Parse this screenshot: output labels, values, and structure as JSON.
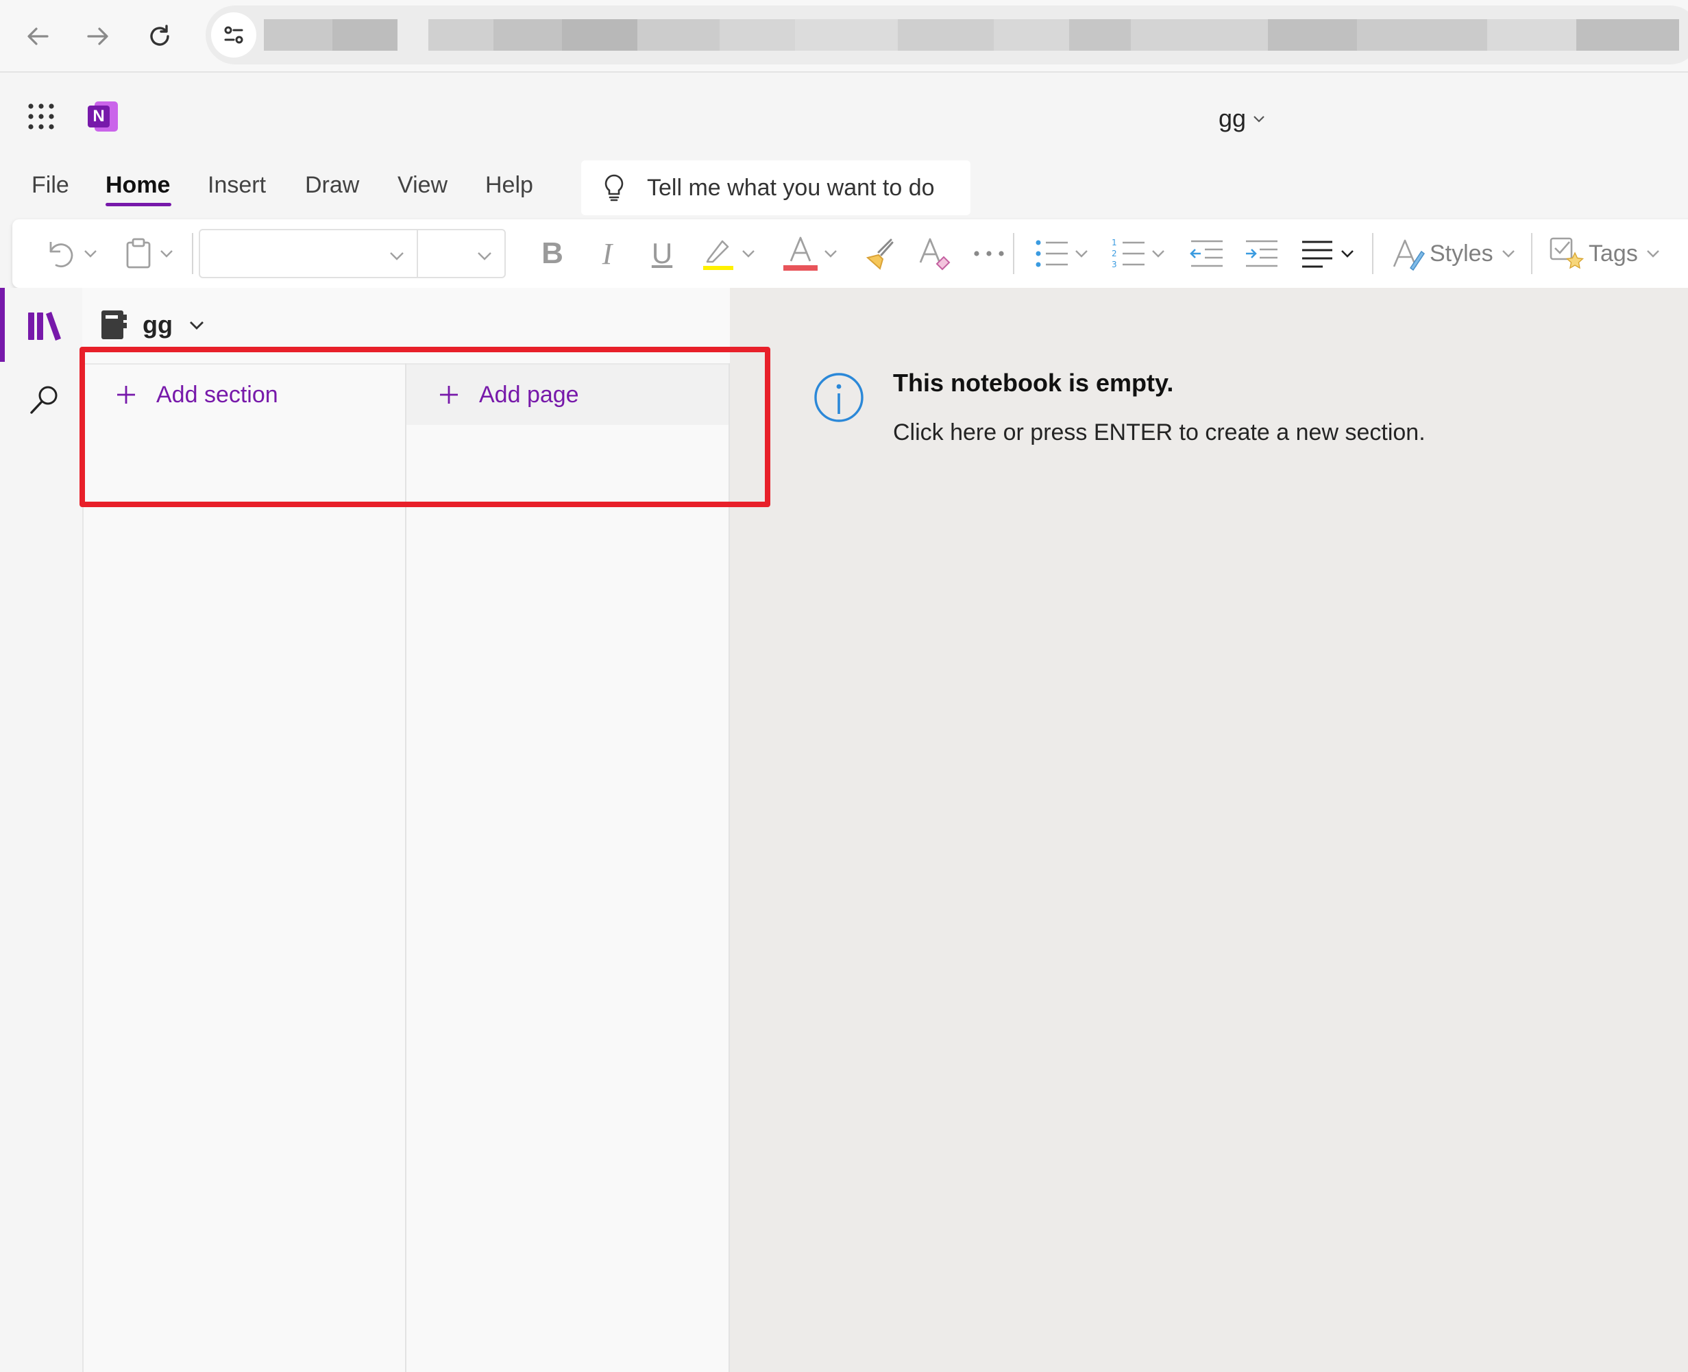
{
  "app": {
    "notebook_title": "gg",
    "logo_letter": "N"
  },
  "ribbon": {
    "tabs": [
      "File",
      "Home",
      "Insert",
      "Draw",
      "View",
      "Help"
    ],
    "active_tab": "Home",
    "tell_me": "Tell me what you want to do"
  },
  "toolbar": {
    "styles_label": "Styles",
    "tags_label": "Tags",
    "bold_glyph": "B",
    "italic_glyph": "I",
    "underline_glyph": "U"
  },
  "notebook": {
    "name": "gg",
    "add_section_label": "Add section",
    "add_page_label": "Add page"
  },
  "content": {
    "empty_title": "This notebook is empty.",
    "empty_message": "Click here or press ENTER to create a new section."
  },
  "colors": {
    "accent": "#7719aa",
    "highlight_box": "#e8202a",
    "info_icon": "#2b88d8",
    "highlighter": "#fff100",
    "font_color": "#e8545a"
  }
}
